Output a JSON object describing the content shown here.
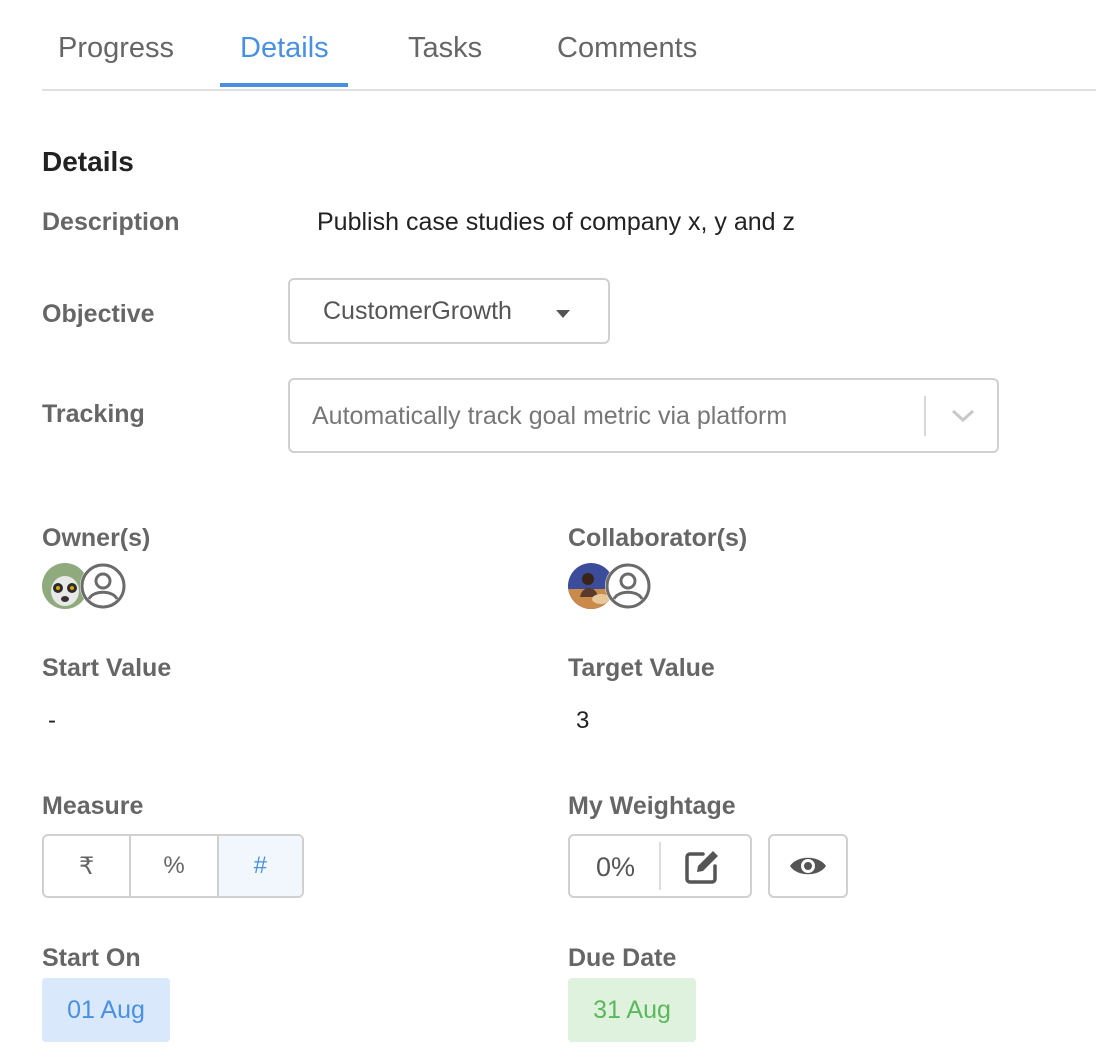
{
  "tabs": [
    {
      "label": "Progress"
    },
    {
      "label": "Details"
    },
    {
      "label": "Tasks"
    },
    {
      "label": "Comments"
    }
  ],
  "active_tab": "Details",
  "section": {
    "title": "Details"
  },
  "description": {
    "label": "Description",
    "value": "Publish case studies of company x, y and z"
  },
  "objective": {
    "label": "Objective",
    "value": "CustomerGrowth"
  },
  "tracking": {
    "label": "Tracking",
    "value": "Automatically track goal metric via platform"
  },
  "owners": {
    "label": "Owner(s)",
    "avatars": [
      "lemur-avatar",
      "default-user-avatar"
    ]
  },
  "collaborators": {
    "label": "Collaborator(s)",
    "avatars": [
      "person-photo-avatar",
      "default-user-avatar"
    ]
  },
  "start_value": {
    "label": "Start Value",
    "value": "-"
  },
  "target_value": {
    "label": "Target Value",
    "value": "3"
  },
  "measure": {
    "label": "Measure",
    "options": [
      "₹",
      "%",
      "#"
    ],
    "selected": "#"
  },
  "weightage": {
    "label": "My Weightage",
    "value": "0%"
  },
  "start_on": {
    "label": "Start On",
    "value": "01 Aug"
  },
  "due_date": {
    "label": "Due Date",
    "value": "31 Aug"
  },
  "colors": {
    "accent": "#4a90e2",
    "due_green": "#5cb85c",
    "start_bg": "#d9e8fb",
    "due_bg": "#dff2dd"
  }
}
